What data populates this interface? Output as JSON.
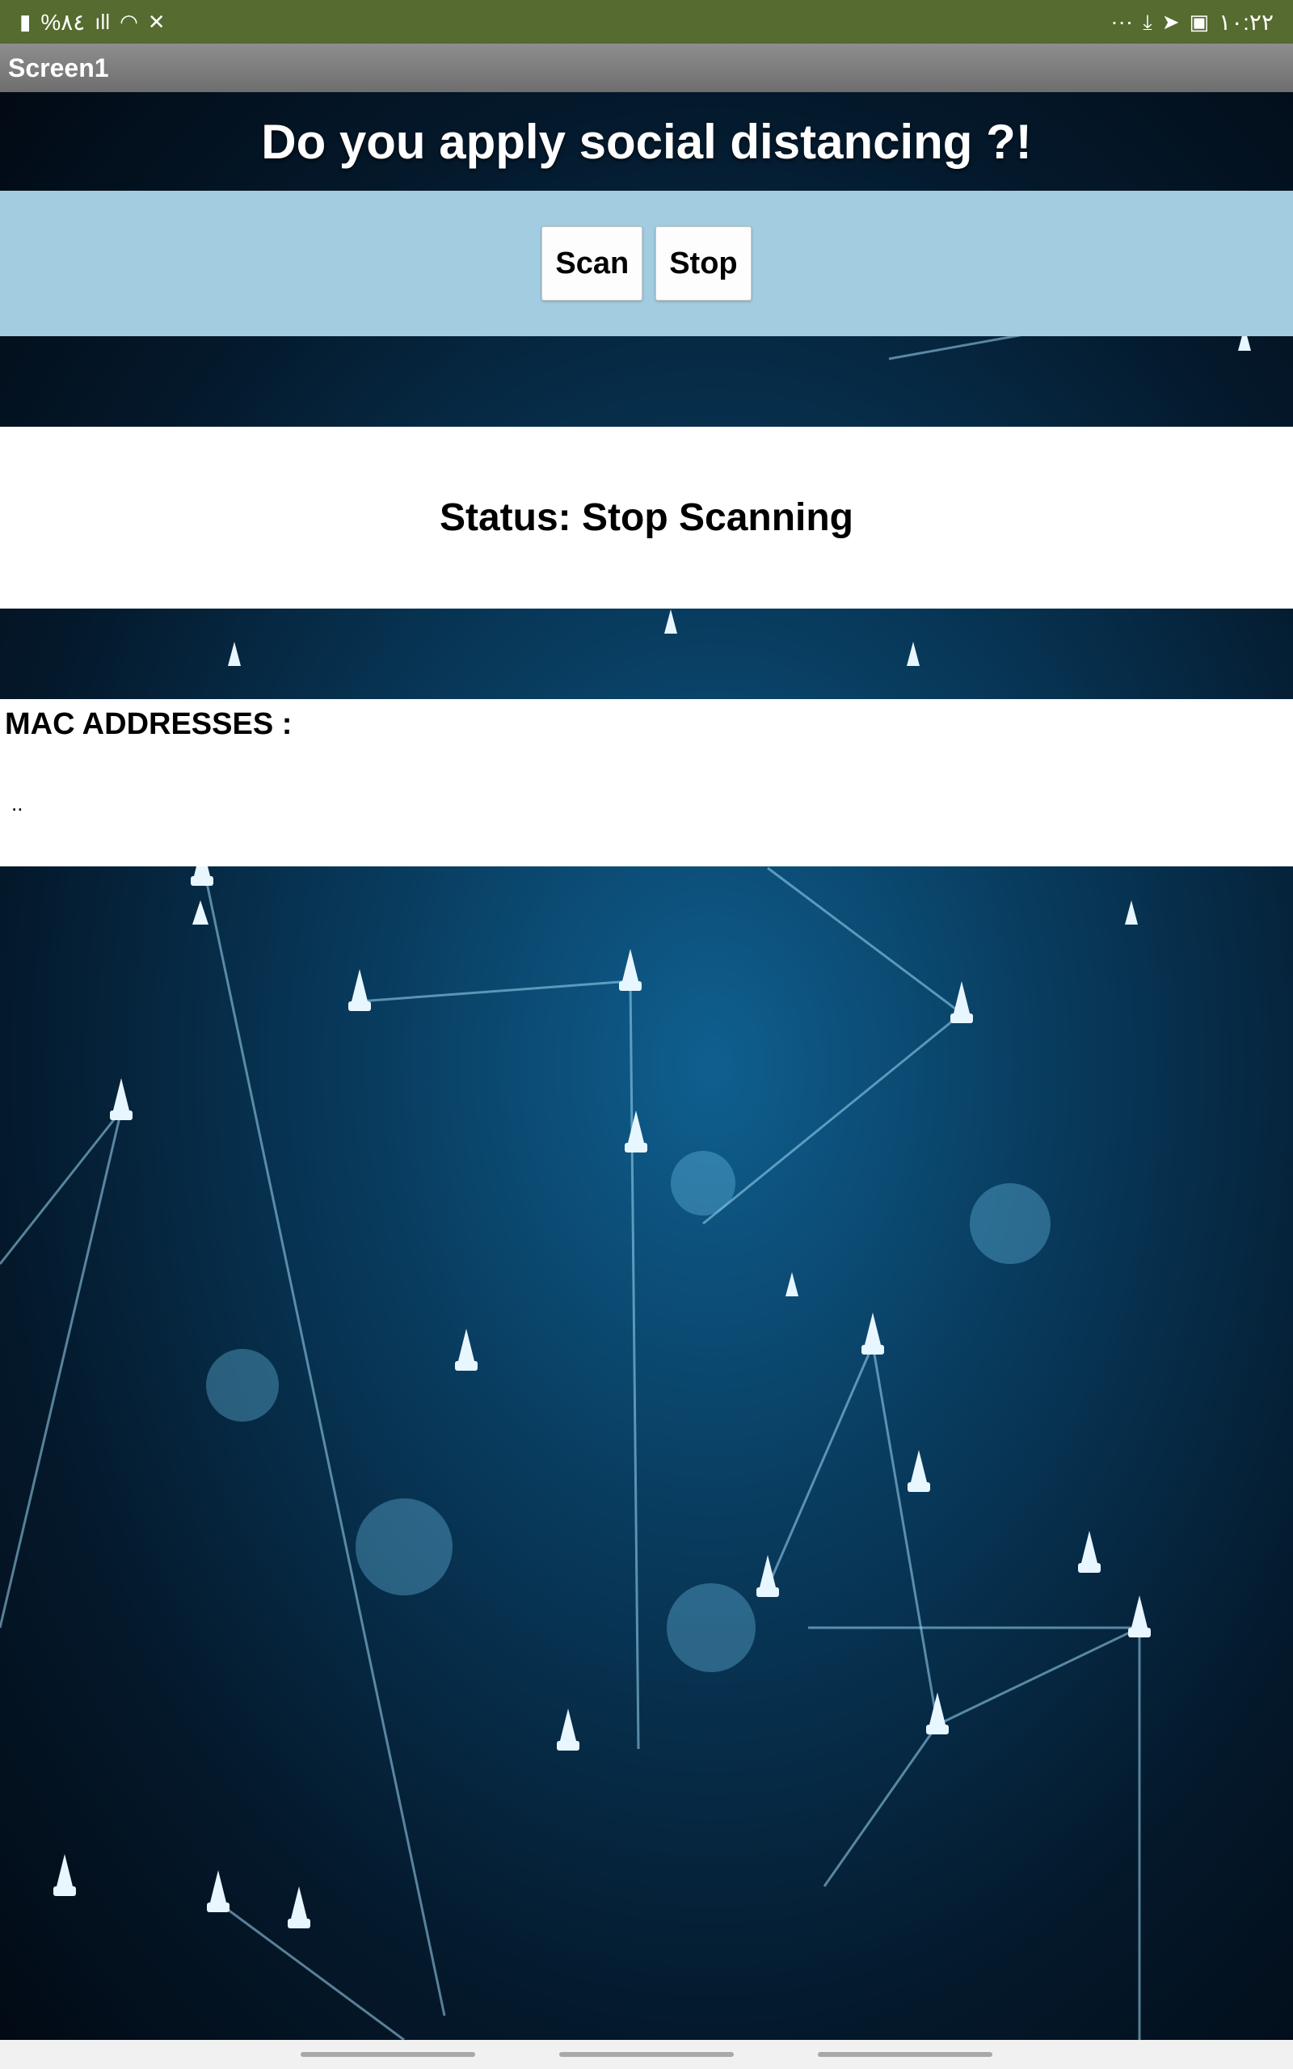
{
  "status_bar": {
    "left_text": "%٨٤",
    "time": "١٠:٢٢",
    "more": "···"
  },
  "app": {
    "title": "Screen1",
    "headline": "Do you apply social distancing ?!"
  },
  "controls": {
    "scan_label": "Scan",
    "stop_label": "Stop"
  },
  "status": {
    "text": "Status: Stop Scanning"
  },
  "mac_addresses": {
    "title": "MAC ADDRESSES :",
    "list_text": ".."
  },
  "colors": {
    "status_bar_bg": "#556b2f",
    "button_row_bg": "#a2cde0",
    "panel_bg": "#ffffff"
  }
}
